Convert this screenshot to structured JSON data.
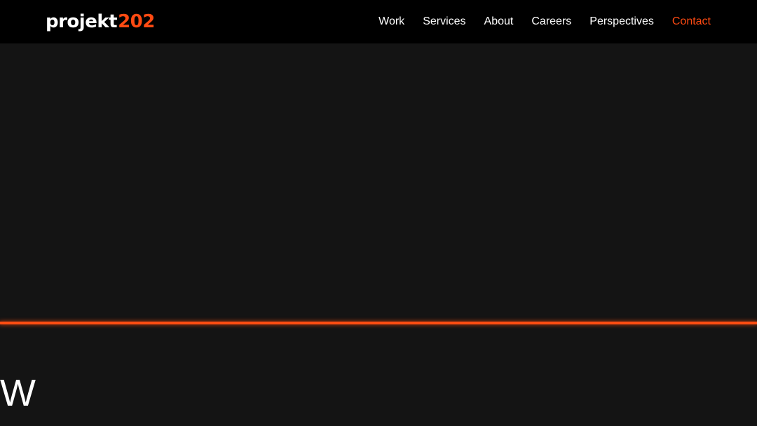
{
  "brand": {
    "name_main": "projekt",
    "name_num": "202",
    "accent_color": "#ff4a12"
  },
  "nav": {
    "items": [
      {
        "label": "Work"
      },
      {
        "label": "Services"
      },
      {
        "label": "About"
      },
      {
        "label": "Careers"
      },
      {
        "label": "Perspectives"
      },
      {
        "label": "Contact",
        "active": true
      }
    ]
  },
  "hero": {
    "headline_partial": "W"
  }
}
